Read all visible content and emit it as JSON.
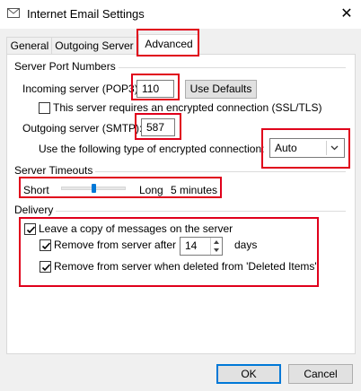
{
  "window": {
    "title": "Internet Email Settings",
    "close_glyph": "✕"
  },
  "tabs": [
    {
      "label": "General"
    },
    {
      "label": "Outgoing Server"
    },
    {
      "label": "Advanced",
      "active": true
    }
  ],
  "server_ports": {
    "group_label": "Server Port Numbers",
    "incoming_label": "Incoming server (POP3):",
    "incoming_value": "110",
    "use_defaults_label": "Use Defaults",
    "encrypted_checkbox_label": "This server requires an encrypted connection (SSL/TLS)",
    "encrypted_checked": false,
    "outgoing_label": "Outgoing server (SMTP):",
    "outgoing_value": "587",
    "encryption_type_label": "Use the following type of encrypted connection:",
    "encryption_type_value": "Auto"
  },
  "timeouts": {
    "group_label": "Server Timeouts",
    "short_label": "Short",
    "long_label": "Long",
    "value_label": "5 minutes",
    "slider_level": 0.5
  },
  "delivery": {
    "group_label": "Delivery",
    "leave_copy_label": "Leave a copy of messages on the server",
    "leave_copy_checked": true,
    "remove_after_label": "Remove from server after",
    "remove_after_checked": true,
    "remove_after_days": "14",
    "days_label": "days",
    "remove_deleted_label": "Remove from server when deleted from 'Deleted Items'",
    "remove_deleted_checked": true
  },
  "buttons": {
    "ok_label": "OK",
    "cancel_label": "Cancel"
  },
  "colors": {
    "highlight": "#e0001b",
    "accent": "#0078d7"
  }
}
